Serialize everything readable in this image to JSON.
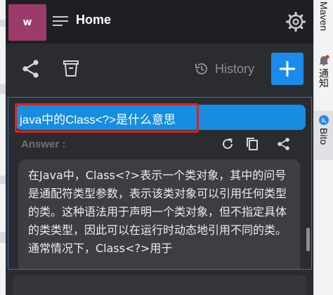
{
  "header": {
    "avatar_letter": "w",
    "home_label": "Home",
    "menu_icon": "hamburger-menu-icon",
    "settings_icon": "gear-icon"
  },
  "toolbar": {
    "share_icon": "share-icon",
    "delete_icon": "trash-icon",
    "history_label": "History",
    "add_label": "+"
  },
  "chat": {
    "question": "java中的Class<?>是什么意思",
    "answer_label": "Answer :",
    "answer_text": "在Java中，Class<?>表示一个类对象，其中的问号是通配符类型参数，表示该类对象可以引用任何类型的类。这种语法用于声明一个类对象，但不指定具体的类类型，因此可以在运行时动态地引用不同的类。通常情况下，Class<?>用于"
  },
  "right_bar": {
    "maven_label": "Maven",
    "notifications_label": "通知",
    "bito_label": "Bito"
  },
  "colors": {
    "accent": "#1a8bea",
    "question_bg": "#168de0",
    "highlight": "#e0201c",
    "avatar_bg": "#9c3b6a"
  }
}
